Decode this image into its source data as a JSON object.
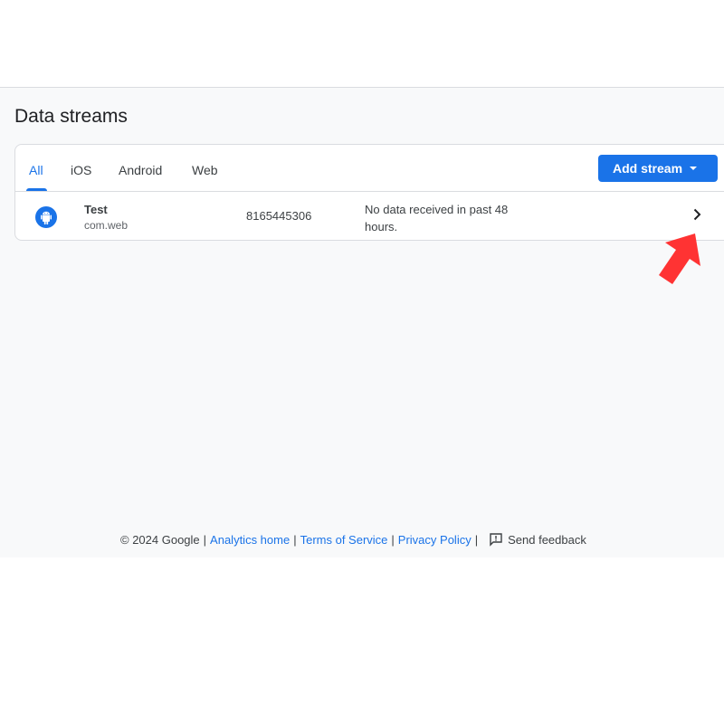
{
  "page": {
    "title": "Data streams"
  },
  "tabs": [
    {
      "label": "All",
      "active": true
    },
    {
      "label": "iOS",
      "active": false
    },
    {
      "label": "Android",
      "active": false
    },
    {
      "label": "Web",
      "active": false
    }
  ],
  "add_stream_button": {
    "label": "Add stream",
    "icon": "caret-down-icon"
  },
  "streams": [
    {
      "icon": "android-icon",
      "name": "Test",
      "package": "com.web",
      "id": "8165445306",
      "status": "No data received in past 48 hours."
    }
  ],
  "annotation": {
    "type": "arrow",
    "color": "#ff3333",
    "points_to": "row-chevron"
  },
  "footer": {
    "copyright": "© 2024 Google",
    "links": [
      "Analytics home",
      "Terms of Service",
      "Privacy Policy"
    ],
    "separator": "|",
    "feedback_label": "Send feedback"
  },
  "colors": {
    "accent": "#1a73e8",
    "background": "#f8f9fa",
    "arrow": "#ff3333"
  }
}
